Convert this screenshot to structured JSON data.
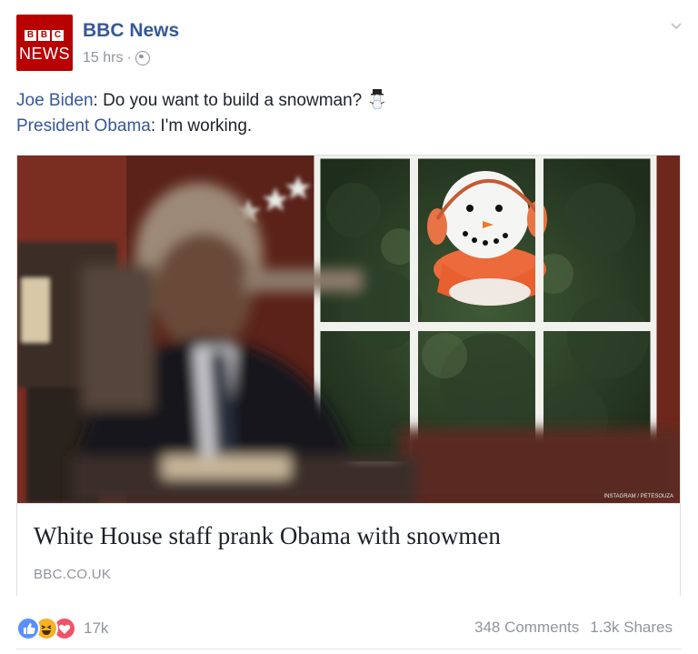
{
  "page": {
    "name": "BBC News",
    "time": "15 hrs",
    "separator": "·",
    "logo_letters": [
      "B",
      "B",
      "C"
    ],
    "logo_word": "NEWS"
  },
  "caption": {
    "line1_speaker": "Joe Biden",
    "line1_text": ": Do you want to build a snowman?",
    "line2_speaker": "President Obama",
    "line2_text": ": I'm working."
  },
  "link_card": {
    "title": "White House staff prank Obama with snowmen",
    "domain": "BBC.CO.UK",
    "watermark": "INSTAGRAM / PETESOUZA"
  },
  "footer": {
    "reaction_icons": [
      "like-icon",
      "haha-icon",
      "love-icon"
    ],
    "reaction_count": "17k",
    "comments": "348 Comments",
    "shares": "1.3k Shares"
  },
  "colors": {
    "link_blue": "#365899",
    "meta_gray": "#90949c",
    "bbc_red": "#b80000",
    "like_blue": "#5890ff",
    "haha_yellow": "#f7b125",
    "love_red": "#f25268"
  }
}
